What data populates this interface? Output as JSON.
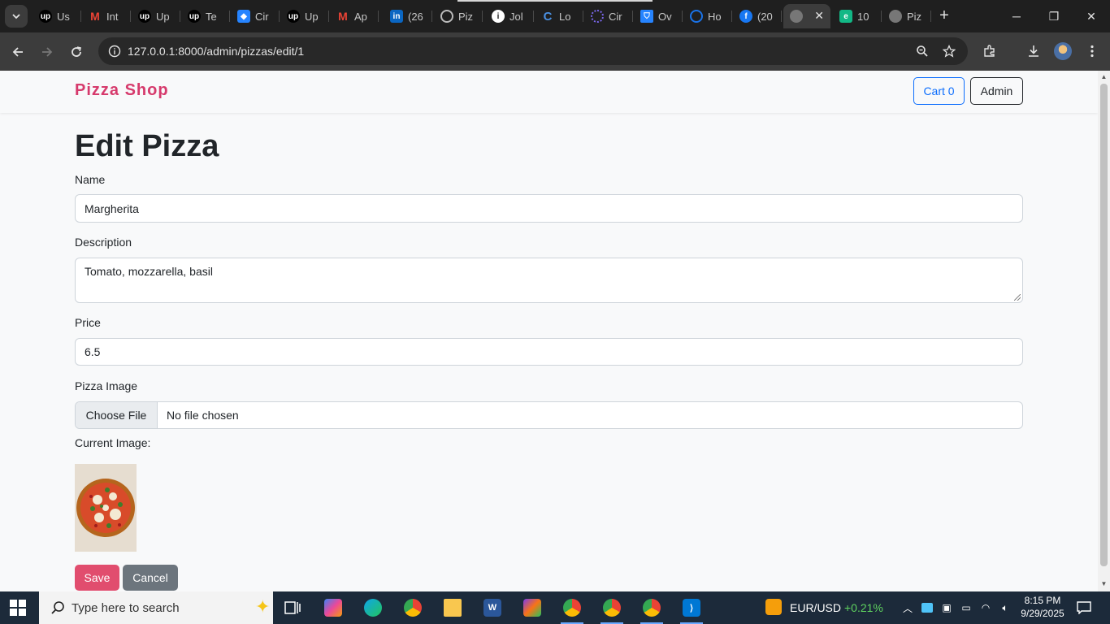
{
  "browser": {
    "tabs": [
      {
        "label": "Us",
        "icon": "upwork-icon",
        "color": "#000000"
      },
      {
        "label": "Int",
        "icon": "gmail-icon",
        "color": "#ea4335"
      },
      {
        "label": "Up",
        "icon": "upwork-icon",
        "color": "#000000"
      },
      {
        "label": "Te",
        "icon": "upwork-icon",
        "color": "#000000"
      },
      {
        "label": "Cir",
        "icon": "jira-icon",
        "color": "#2684ff"
      },
      {
        "label": "Up",
        "icon": "upwork-icon",
        "color": "#000000"
      },
      {
        "label": "Ap",
        "icon": "gmail-icon",
        "color": "#ea4335"
      },
      {
        "label": "(26",
        "icon": "linkedin-icon",
        "color": "#0a66c2"
      },
      {
        "label": "Piz",
        "icon": "chatgpt-icon",
        "color": "#9a9a9a"
      },
      {
        "label": "Jol",
        "icon": "info-icon",
        "color": "#ffffff"
      },
      {
        "label": "Lo",
        "icon": "loom-icon",
        "color": "#4a90e2"
      },
      {
        "label": "Cir",
        "icon": "circle-dots-icon",
        "color": "#7b68ee"
      },
      {
        "label": "Ov",
        "icon": "bitbucket-icon",
        "color": "#2684ff"
      },
      {
        "label": "Ho",
        "icon": "swirl-icon",
        "color": "#1a73e8"
      },
      {
        "label": "(20",
        "icon": "facebook-icon",
        "color": "#1877f2"
      },
      {
        "label": "",
        "icon": "globe-icon",
        "color": "#9a9a9a",
        "active": true
      },
      {
        "label": "10",
        "icon": "e-icon",
        "color": "#12b886"
      },
      {
        "label": "Piz",
        "icon": "globe-icon",
        "color": "#9a9a9a"
      }
    ],
    "url": "127.0.0.1:8000/admin/pizzas/edit/1"
  },
  "navbar": {
    "brand": "Pizza Shop",
    "cart_label": "Cart 0",
    "admin_label": "Admin"
  },
  "form": {
    "title": "Edit Pizza",
    "name_label": "Name",
    "name_value": "Margherita",
    "description_label": "Description",
    "description_value": "Tomato, mozzarella, basil",
    "price_label": "Price",
    "price_value": "6.5",
    "image_label": "Pizza Image",
    "choose_file_label": "Choose File",
    "file_status": "No file chosen",
    "current_image_label": "Current Image:",
    "save_label": "Save",
    "cancel_label": "Cancel"
  },
  "taskbar": {
    "search_placeholder": "Type here to search",
    "ticker": "EUR/USD",
    "ticker_change": "+0.21%",
    "time": "8:15 PM",
    "date": "9/29/2025"
  },
  "colors": {
    "brand": "#d63a6c",
    "primary": "#0d6efd",
    "save": "#e14d6e",
    "cancel": "#6c757d",
    "ticker_up": "#5fd35f"
  }
}
